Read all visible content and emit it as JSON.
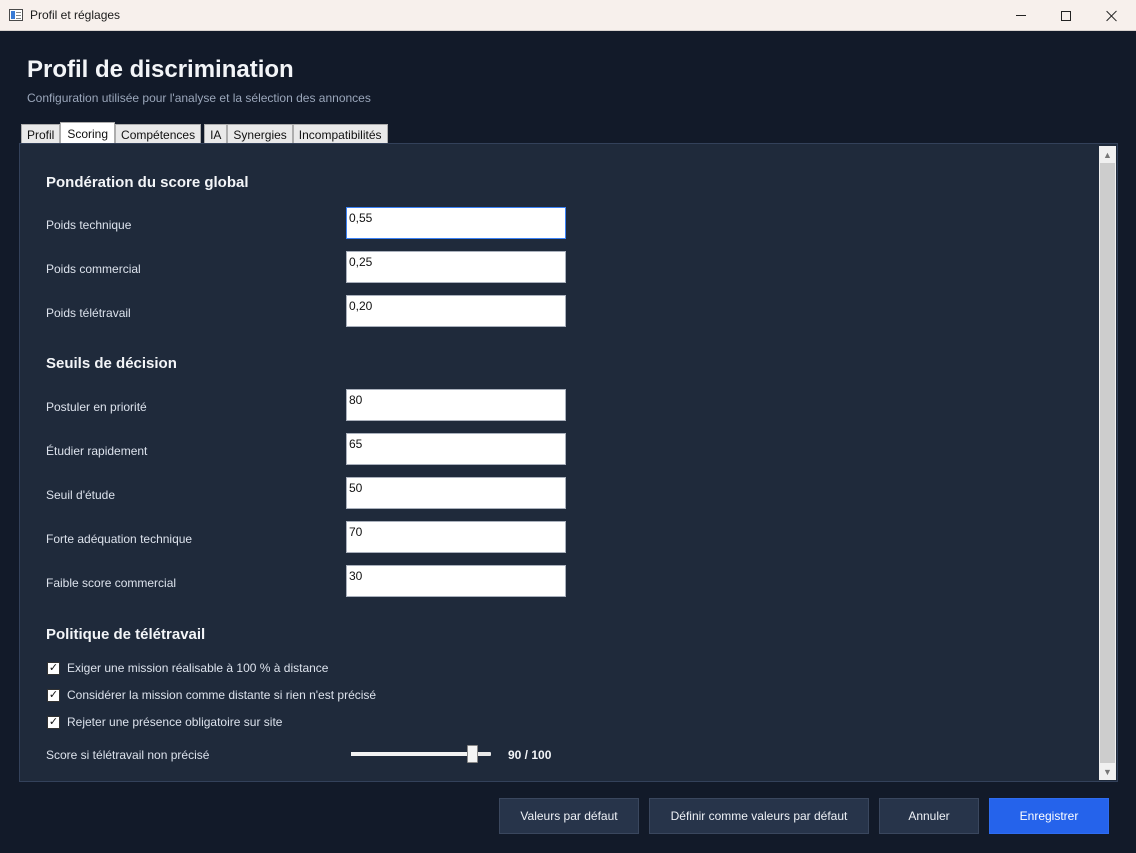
{
  "window": {
    "title": "Profil et réglages"
  },
  "header": {
    "title": "Profil de discrimination",
    "subtitle": "Configuration utilisée pour l'analyse et la sélection des annonces"
  },
  "tabs": [
    {
      "label": "Profil"
    },
    {
      "label": "Scoring",
      "active": true
    },
    {
      "label": "Compétences"
    },
    {
      "label": "IA"
    },
    {
      "label": "Synergies"
    },
    {
      "label": "Incompatibilités"
    }
  ],
  "weights": {
    "title": "Pondération du score global",
    "fields": [
      {
        "label": "Poids technique",
        "value": "0,55"
      },
      {
        "label": "Poids commercial",
        "value": "0,25"
      },
      {
        "label": "Poids télétravail",
        "value": "0,20"
      }
    ]
  },
  "thresholds": {
    "title": "Seuils de décision",
    "fields": [
      {
        "label": "Postuler en priorité",
        "value": "80"
      },
      {
        "label": "Étudier rapidement",
        "value": "65"
      },
      {
        "label": "Seuil d'étude",
        "value": "50"
      },
      {
        "label": "Forte adéquation technique",
        "value": "70"
      },
      {
        "label": "Faible score commercial",
        "value": "30"
      }
    ]
  },
  "remote": {
    "title": "Politique de télétravail",
    "checks": [
      {
        "label": "Exiger une mission réalisable à 100 % à distance",
        "checked": true
      },
      {
        "label": "Considérer la mission comme distante si rien n'est précisé",
        "checked": true
      },
      {
        "label": "Rejeter une présence obligatoire sur site",
        "checked": true
      }
    ],
    "slider": {
      "label": "Score si télétravail non précisé",
      "value": 90,
      "max": 100,
      "value_text": "90 / 100"
    }
  },
  "footer": {
    "defaults": "Valeurs par défaut",
    "set_defaults": "Définir comme valeurs par défaut",
    "cancel": "Annuler",
    "save": "Enregistrer"
  },
  "colors": {
    "background": "#121a29",
    "panel": "#1f2a3b",
    "primary": "#2563eb"
  }
}
